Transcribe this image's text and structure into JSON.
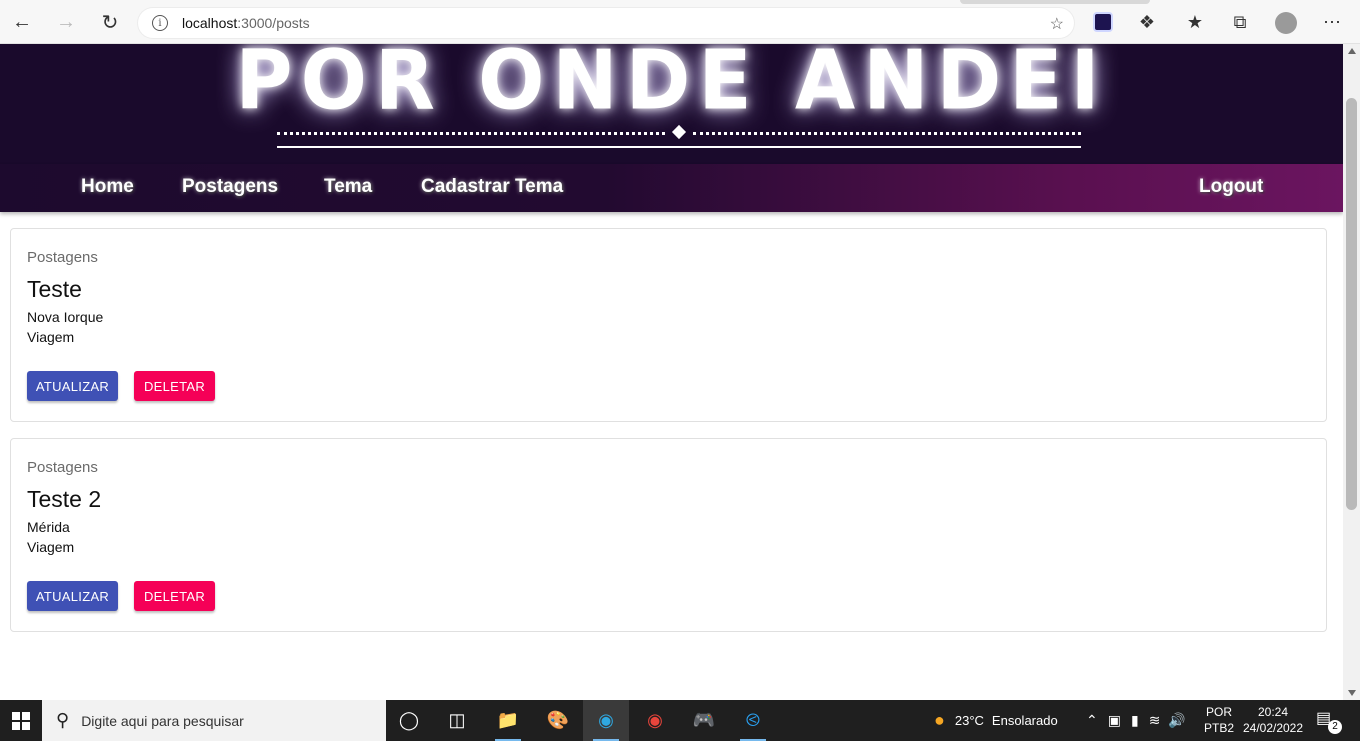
{
  "browser": {
    "url_host": "localhost",
    "url_path": ":3000/posts"
  },
  "banner": {
    "title": "POR ONDE ANDEI"
  },
  "navbar": {
    "items": [
      {
        "label": "Home"
      },
      {
        "label": "Postagens"
      },
      {
        "label": "Tema"
      },
      {
        "label": "Cadastrar Tema"
      }
    ],
    "logout_label": "Logout"
  },
  "posts": [
    {
      "overline": "Postagens",
      "title": "Teste",
      "text": "Nova Iorque",
      "theme": "Viagem",
      "update_label": "ATUALIZAR",
      "delete_label": "DELETAR"
    },
    {
      "overline": "Postagens",
      "title": "Teste 2",
      "text": "Mérida",
      "theme": "Viagem",
      "update_label": "ATUALIZAR",
      "delete_label": "DELETAR"
    }
  ],
  "colors": {
    "update_button": "#3f51b5",
    "delete_button": "#f50057",
    "banner_bg": "#1a0a2c"
  },
  "taskbar": {
    "search_placeholder": "Digite aqui para pesquisar",
    "weather_temp": "23°C",
    "weather_desc": "Ensolarado",
    "lang_top": "POR",
    "lang_bottom": "PTB2",
    "time": "20:24",
    "date": "24/02/2022",
    "notification_count": "2"
  }
}
